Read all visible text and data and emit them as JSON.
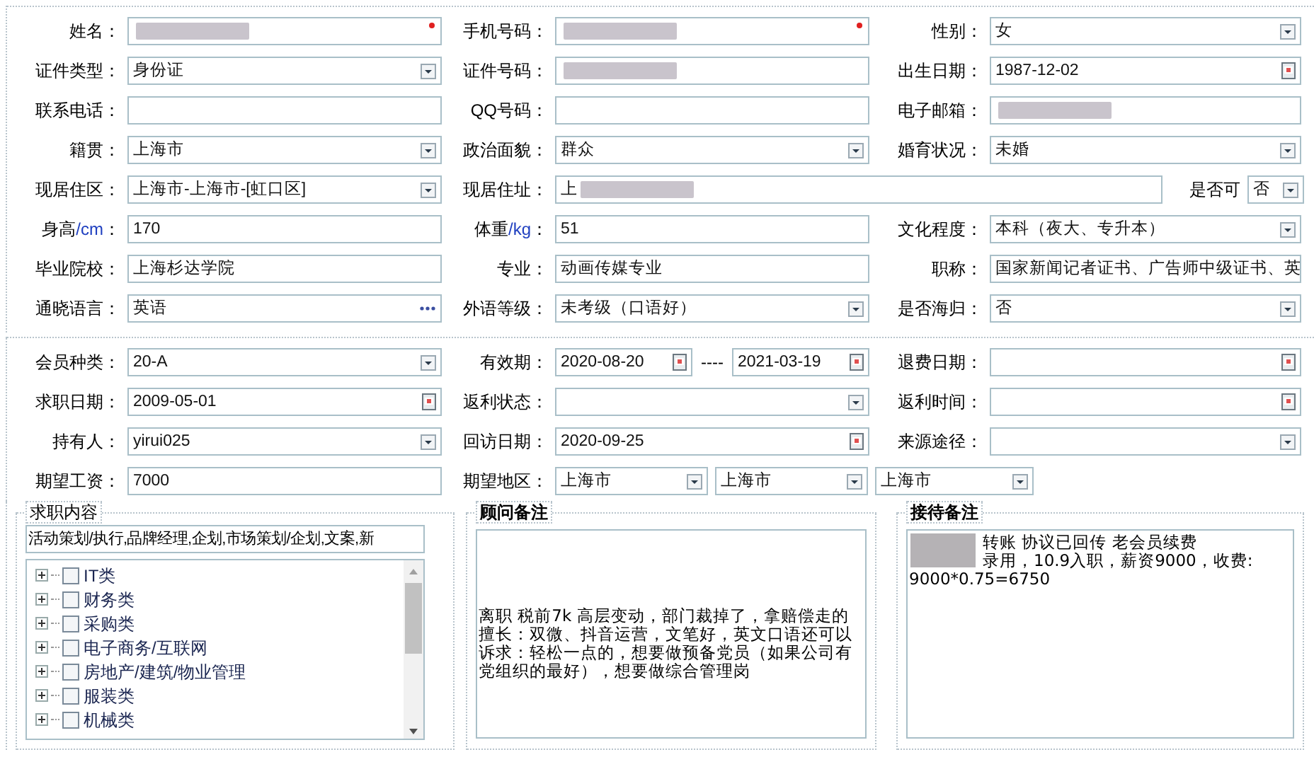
{
  "profile_section": {
    "rows": [
      [
        {
          "kind": "single",
          "label": "姓名：",
          "fields": [
            {
              "kind": "text",
              "redacted": true,
              "required": true
            }
          ]
        },
        {
          "kind": "single",
          "label": "手机号码：",
          "fields": [
            {
              "kind": "text",
              "redacted": true,
              "required": true
            }
          ]
        },
        {
          "kind": "single",
          "label": "性别：",
          "fields": [
            {
              "kind": "select",
              "value": "女"
            }
          ]
        }
      ],
      [
        {
          "kind": "single",
          "label": "证件类型：",
          "fields": [
            {
              "kind": "select",
              "value": "身份证"
            }
          ]
        },
        {
          "kind": "single",
          "label": "证件号码：",
          "fields": [
            {
              "kind": "text",
              "redacted": true
            }
          ]
        },
        {
          "kind": "single",
          "label": "出生日期：",
          "fields": [
            {
              "kind": "date",
              "value": "1987-12-02"
            }
          ]
        }
      ],
      [
        {
          "kind": "single",
          "label": "联系电话：",
          "fields": [
            {
              "kind": "text"
            }
          ]
        },
        {
          "kind": "single",
          "label": "QQ号码：",
          "fields": [
            {
              "kind": "text"
            }
          ]
        },
        {
          "kind": "single",
          "label": "电子邮箱：",
          "fields": [
            {
              "kind": "text",
              "redacted": true
            }
          ]
        }
      ],
      [
        {
          "kind": "single",
          "label": "籍贯：",
          "fields": [
            {
              "kind": "select",
              "value": "上海市"
            }
          ]
        },
        {
          "kind": "single",
          "label": "政治面貌：",
          "fields": [
            {
              "kind": "select",
              "value": "群众"
            }
          ]
        },
        {
          "kind": "single",
          "label": "婚育状况：",
          "fields": [
            {
              "kind": "select",
              "value": "未婚"
            }
          ]
        }
      ],
      [
        {
          "kind": "single",
          "label": "现居住区：",
          "fields": [
            {
              "kind": "select",
              "value": "上海市-上海市-[虹口区]"
            }
          ]
        },
        {
          "kind": "wide",
          "label": "现居住址：",
          "fields": [
            {
              "kind": "text",
              "value": "上",
              "redacted": true
            }
          ],
          "extra": {
            "label": "是否可",
            "field": {
              "kind": "select",
              "value": "否"
            }
          }
        }
      ],
      [
        {
          "kind": "single",
          "label": "身高",
          "unit": "/cm",
          "colon": "：",
          "fields": [
            {
              "kind": "text",
              "value": "170"
            }
          ]
        },
        {
          "kind": "single",
          "label": "体重",
          "unit": "/kg",
          "colon": "：",
          "fields": [
            {
              "kind": "text",
              "value": "51"
            }
          ]
        },
        {
          "kind": "single",
          "label": "文化程度：",
          "fields": [
            {
              "kind": "select",
              "value": "本科（夜大、专升本）"
            }
          ]
        }
      ],
      [
        {
          "kind": "single",
          "label": "毕业院校：",
          "fields": [
            {
              "kind": "text",
              "value": "上海杉达学院"
            }
          ]
        },
        {
          "kind": "single",
          "label": "专业：",
          "fields": [
            {
              "kind": "text",
              "value": "动画传媒专业"
            }
          ]
        },
        {
          "kind": "single",
          "label": "职称：",
          "fields": [
            {
              "kind": "text",
              "value": "国家新闻记者证书、广告师中级证书、英"
            }
          ]
        }
      ],
      [
        {
          "kind": "single",
          "label": "通晓语言：",
          "fields": [
            {
              "kind": "lookup",
              "value": "英语"
            }
          ]
        },
        {
          "kind": "single",
          "label": "外语等级：",
          "fields": [
            {
              "kind": "select",
              "value": "未考级（口语好）"
            }
          ]
        },
        {
          "kind": "single",
          "label": "是否海归：",
          "fields": [
            {
              "kind": "select",
              "value": "否"
            }
          ]
        }
      ]
    ]
  },
  "membership_section": {
    "rows": [
      [
        {
          "kind": "single",
          "label": "会员种类：",
          "fields": [
            {
              "kind": "select",
              "value": "20-A"
            }
          ]
        },
        {
          "kind": "range",
          "label": "有效期：",
          "separator": "----",
          "fields": [
            {
              "kind": "date",
              "value": "2020-08-20"
            },
            {
              "kind": "date",
              "value": "2021-03-19"
            }
          ]
        },
        {
          "kind": "single",
          "label": "退费日期：",
          "fields": [
            {
              "kind": "date"
            }
          ]
        }
      ],
      [
        {
          "kind": "single",
          "label": "求职日期：",
          "fields": [
            {
              "kind": "date",
              "value": "2009-05-01"
            }
          ]
        },
        {
          "kind": "single",
          "label": "返利状态：",
          "fields": [
            {
              "kind": "select"
            }
          ]
        },
        {
          "kind": "single",
          "label": "返利时间：",
          "fields": [
            {
              "kind": "date"
            }
          ]
        }
      ],
      [
        {
          "kind": "single",
          "label": "持有人：",
          "fields": [
            {
              "kind": "select",
              "value": "yirui025"
            }
          ]
        },
        {
          "kind": "single",
          "label": "回访日期：",
          "fields": [
            {
              "kind": "date",
              "value": "2020-09-25"
            }
          ]
        },
        {
          "kind": "single",
          "label": "来源途径：",
          "fields": [
            {
              "kind": "select"
            }
          ]
        }
      ],
      [
        {
          "kind": "single",
          "label": "期望工资：",
          "fields": [
            {
              "kind": "text",
              "value": "7000"
            }
          ]
        },
        {
          "kind": "region",
          "label": "期望地区：",
          "fields": [
            {
              "kind": "select",
              "value": "上海市"
            },
            {
              "kind": "select",
              "value": "上海市"
            },
            {
              "kind": "select",
              "value": "上海市"
            }
          ]
        }
      ]
    ]
  },
  "job_content": {
    "legend": "求职内容",
    "summary": "活动策划/执行,品牌经理,企划,市场策划/企划,文案,新",
    "tree": [
      {
        "label": "IT类",
        "expanded": false,
        "checked": false
      },
      {
        "label": "财务类",
        "expanded": false,
        "checked": false
      },
      {
        "label": "采购类",
        "expanded": false,
        "checked": false
      },
      {
        "label": "电子商务/互联网",
        "expanded": false,
        "checked": false
      },
      {
        "label": "房地产/建筑/物业管理",
        "expanded": false,
        "checked": false
      },
      {
        "label": "服装类",
        "expanded": false,
        "checked": false
      },
      {
        "label": "机械类",
        "expanded": false,
        "checked": false
      }
    ]
  },
  "advisor_notes": {
    "legend": "顾问备注",
    "lines": [
      "离职 税前7k 高层变动，部门裁掉了，拿赔偿走的",
      "擅长：双微、抖音运营，文笔好，英文口语还可以",
      "诉求：轻松一点的，想要做预备党员（如果公司有党组织的最好），想要做综合管理岗"
    ]
  },
  "reception_notes": {
    "legend": "接待备注",
    "redacted": true,
    "lines": [
      "转账    协议已回传    老会员续费",
      "录用，10.9入职，薪资9000，收费:",
      "9000*0.75=6750"
    ]
  }
}
